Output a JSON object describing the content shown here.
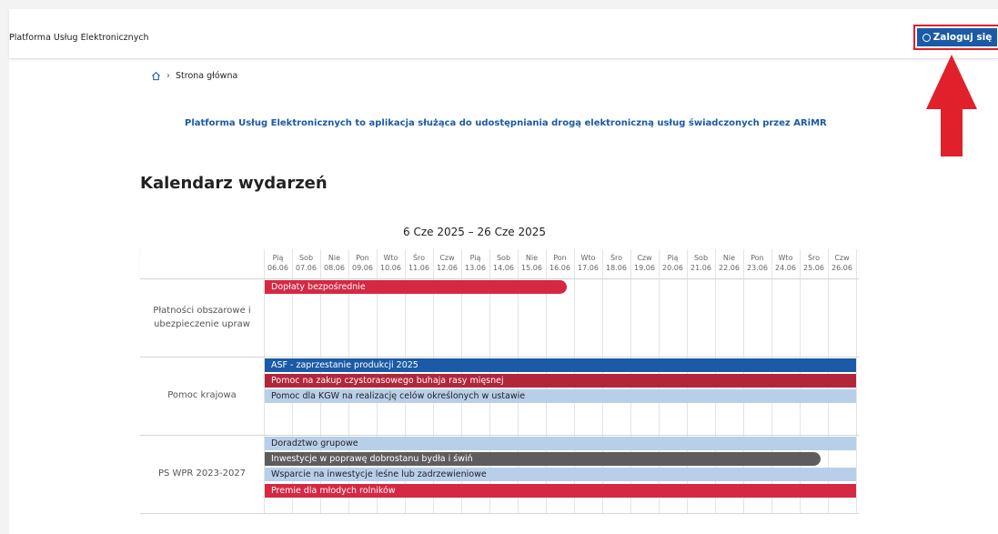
{
  "app": {
    "title": "Platforma Usług Elektronicznych"
  },
  "header": {
    "login_label": "Zaloguj się"
  },
  "breadcrumb": {
    "home_label": "Strona główna"
  },
  "intro": {
    "text": "Platforma Usług Elektronicznych to aplikacja służąca do udostępniania drogą elektroniczną usług świadczonych przez ARiMR"
  },
  "calendar": {
    "title": "Kalendarz wydarzeń",
    "range": "6 Cze 2025 – 26 Cze 2025",
    "days": [
      {
        "dow": "Pią",
        "date": "06.06"
      },
      {
        "dow": "Sob",
        "date": "07.06"
      },
      {
        "dow": "Nie",
        "date": "08.06"
      },
      {
        "dow": "Pon",
        "date": "09.06"
      },
      {
        "dow": "Wto",
        "date": "10.06"
      },
      {
        "dow": "Śro",
        "date": "11.06"
      },
      {
        "dow": "Czw",
        "date": "12.06"
      },
      {
        "dow": "Pią",
        "date": "13.06"
      },
      {
        "dow": "Sob",
        "date": "14.06"
      },
      {
        "dow": "Nie",
        "date": "15.06"
      },
      {
        "dow": "Pon",
        "date": "16.06"
      },
      {
        "dow": "Wto",
        "date": "17.06"
      },
      {
        "dow": "Śro",
        "date": "18.06"
      },
      {
        "dow": "Czw",
        "date": "19.06"
      },
      {
        "dow": "Pią",
        "date": "20.06"
      },
      {
        "dow": "Sob",
        "date": "21.06"
      },
      {
        "dow": "Nie",
        "date": "22.06"
      },
      {
        "dow": "Pon",
        "date": "23.06"
      },
      {
        "dow": "Wto",
        "date": "24.06"
      },
      {
        "dow": "Śro",
        "date": "25.06"
      },
      {
        "dow": "Czw",
        "date": "26.06"
      }
    ],
    "groups": [
      {
        "name": "Płatności obszarowe i ubezpieczenie upraw",
        "events": [
          {
            "label": "Dopłaty bezpośrednie",
            "start": "06.06",
            "end": "16.06",
            "color": "#d62843",
            "text_color": "#ffffff",
            "continues": false
          }
        ]
      },
      {
        "name": "Pomoc krajowa",
        "events": [
          {
            "label": "ASF - zaprzestanie produkcji 2025",
            "start": "06.06",
            "end": "26.06",
            "color": "#1b5aa6",
            "text_color": "#ffffff",
            "continues": true
          },
          {
            "label": "Pomoc na zakup czystorasowego buhaja rasy mięsnej",
            "start": "06.06",
            "end": "26.06",
            "color": "#b3263a",
            "text_color": "#ffffff",
            "continues": true
          },
          {
            "label": "Pomoc dla KGW na realizację celów określonych w ustawie",
            "start": "06.06",
            "end": "26.06",
            "color": "#b8cfea",
            "text_color": "#222222",
            "continues": true
          }
        ]
      },
      {
        "name": "PS WPR 2023-2027",
        "events": [
          {
            "label": "Doradztwo grupowe",
            "start": "06.06",
            "end": "26.06",
            "color": "#b8cfea",
            "text_color": "#222222",
            "continues": true
          },
          {
            "label": "Inwestycje w poprawę dobrostanu bydła i świń",
            "start": "06.06",
            "end": "25.06",
            "color": "#5d5d5d",
            "text_color": "#ffffff",
            "continues": false
          },
          {
            "label": "Wsparcie na inwestycje leśne lub zadrzewieniowe",
            "start": "06.06",
            "end": "26.06",
            "color": "#b8cfea",
            "text_color": "#222222",
            "continues": true
          },
          {
            "label": "Premie dla młodych rolników",
            "start": "06.06",
            "end": "26.06",
            "color": "#d62843",
            "text_color": "#ffffff",
            "continues": true
          }
        ]
      }
    ]
  },
  "colors": {
    "accent": "#1b5aa6",
    "alert": "#e0202a"
  }
}
